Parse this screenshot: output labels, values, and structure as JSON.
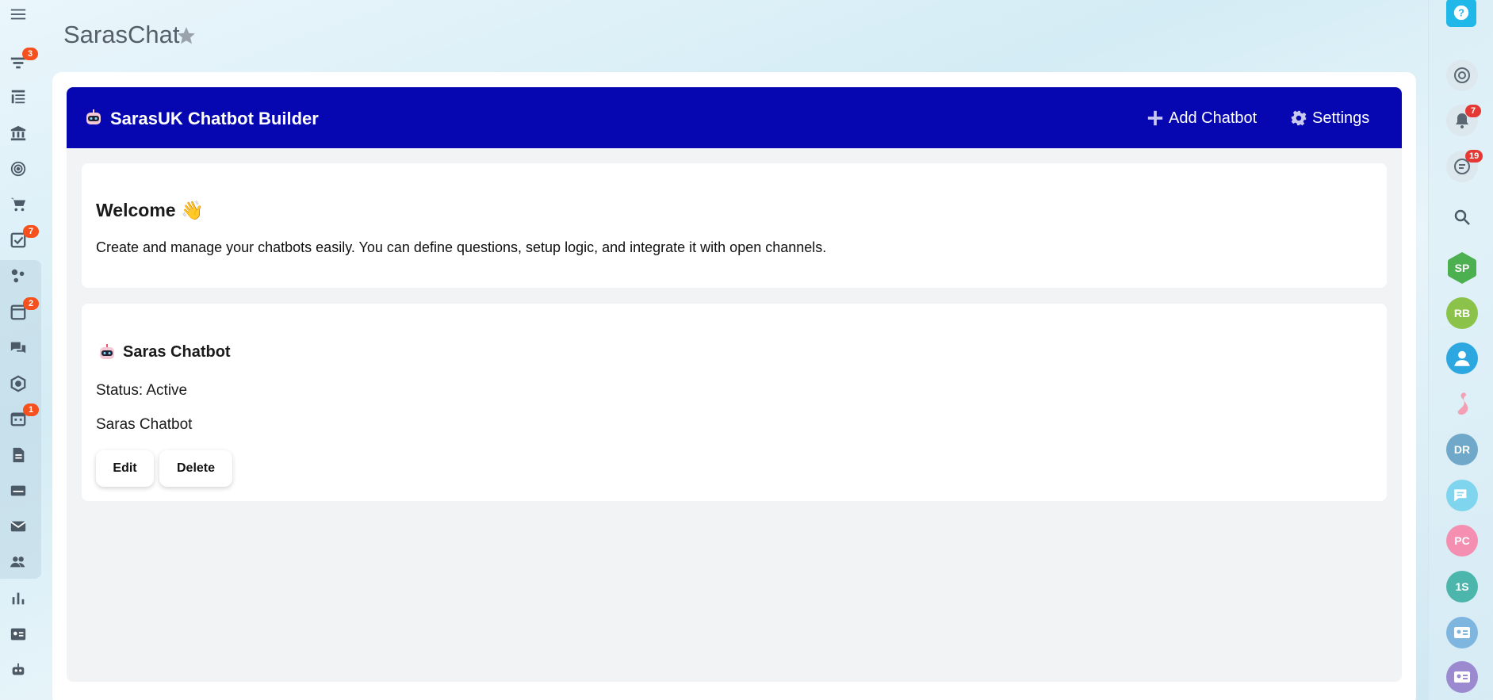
{
  "app": {
    "title": "SarasChat"
  },
  "header": {
    "title": "SarasUK Chatbot Builder",
    "add_label": "Add Chatbot",
    "settings_label": "Settings"
  },
  "welcome": {
    "heading": "Welcome 👋",
    "text": "Create and manage your chatbots easily. You can define questions, setup logic, and integrate it with open channels."
  },
  "chatbot": {
    "name": "Saras Chatbot",
    "status": "Status: Active",
    "description": "Saras Chatbot",
    "edit_label": "Edit",
    "delete_label": "Delete"
  },
  "left_sidebar": {
    "badges": {
      "filters": "3",
      "tasks": "7",
      "feed": "2",
      "calendar": "1"
    }
  },
  "right_sidebar": {
    "notifications_badge": "7",
    "chats_badge": "19",
    "avatars": [
      {
        "initials": "SP",
        "color": "#4caf50"
      },
      {
        "initials": "RB",
        "color": "#8bc34a"
      },
      {
        "initials": "DR",
        "color": "#6fa8c8"
      },
      {
        "initials": "PC",
        "color": "#f48fb1"
      },
      {
        "initials": "1S",
        "color": "#4db6ac"
      }
    ]
  },
  "colors": {
    "header_bg": "#0707b2",
    "badge": "#f4511e"
  }
}
